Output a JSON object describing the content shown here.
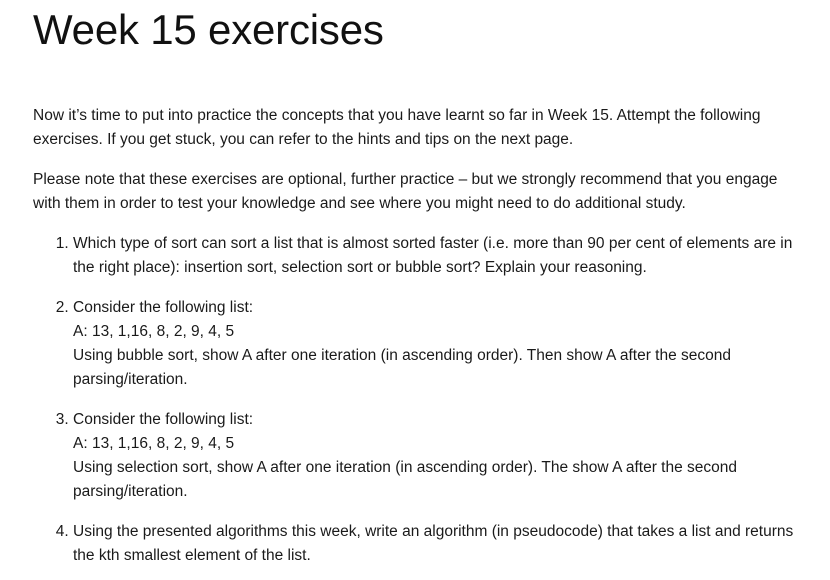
{
  "page": {
    "title": "Week 15 exercises",
    "intro_1": "Now it’s time to put into practice the concepts that you have learnt so far in Week 15. Attempt the following exercises. If you get stuck, you can refer to the hints and tips on the next page.",
    "intro_2": "Please note that these exercises are optional, further practice – but we strongly recommend that you engage with them in order to test your knowledge and see where you might need to do additional study."
  },
  "exercises": [
    {
      "text": "Which type of sort can sort a list that is almost sorted faster (i.e. more than 90 per cent of elements are in the right place): insertion sort, selection sort or bubble sort? Explain your reasoning."
    },
    {
      "line1": "Consider the following list:",
      "line2": "A: 13, 1,16, 8, 2, 9, 4, 5",
      "line3": "Using bubble sort, show A after one iteration (in ascending order). Then show A after the second parsing/iteration."
    },
    {
      "line1": "Consider the following list:",
      "line2": "A: 13, 1,16, 8, 2, 9, 4, 5",
      "line3": "Using selection sort, show A after one iteration (in ascending order). The show A after the second parsing/iteration."
    },
    {
      "text": "Using the presented algorithms this week, write an algorithm (in pseudocode) that takes a list and returns the kth smallest element of the list."
    }
  ]
}
